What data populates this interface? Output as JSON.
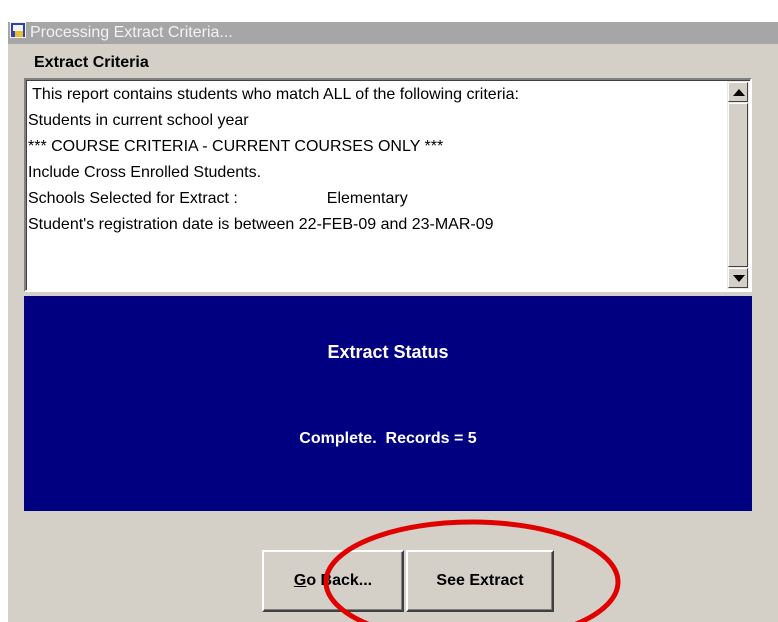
{
  "window": {
    "title": "Processing Extract Criteria...",
    "icon": "form-app-icon"
  },
  "criteria": {
    "label": "Extract Criteria",
    "lines": [
      " This report contains students who match ALL of the following criteria:",
      "Students in current school year",
      "*** COURSE CRITERIA - CURRENT COURSES ONLY ***",
      "Include Cross Enrolled Students.",
      "Schools Selected for Extract :                    Elementary",
      "Student's registration date is between 22-FEB-09 and 23-MAR-09"
    ]
  },
  "status": {
    "title": "Extract Status",
    "message": "Complete.  Records = 5"
  },
  "buttons": {
    "go_back": {
      "mnemonic": "G",
      "rest": "o Back..."
    },
    "see_extract": "See Extract"
  },
  "colors": {
    "window_bg": "#d4d0c8",
    "status_bg": "#000080",
    "titlebar_bg": "#a6a6a6",
    "highlight": "#e00000"
  }
}
